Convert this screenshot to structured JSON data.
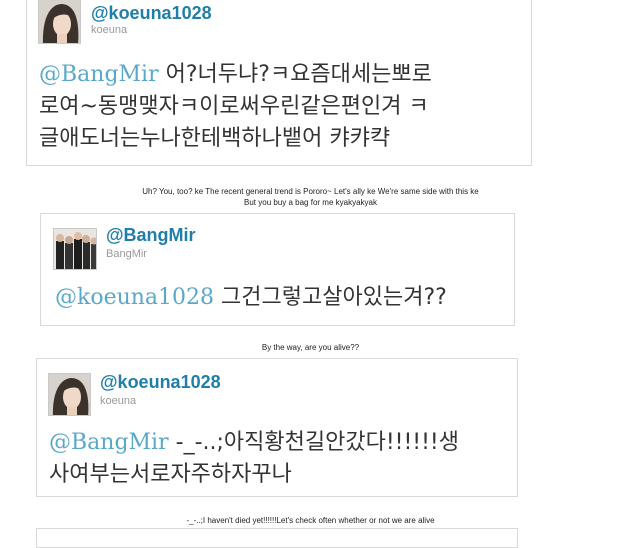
{
  "tweet1": {
    "handle": "@koeuna1028",
    "username": "koeuna",
    "mention": "@BangMir",
    "line1": "어?너두냐?ㅋ요즘대세는뽀로",
    "line2": "로여~동맹맺자ㅋ이로써우린같은편인겨 ㅋ",
    "line3": "글애도너는누나한테백하나뱉어 캬캬캭"
  },
  "caption1": {
    "line1": "Uh? You, too? ke The recent general trend is Pororo~ Let's ally ke We're same side with this ke",
    "line2": "But you buy a bag for me kyakyakyak"
  },
  "tweet2": {
    "handle": "@BangMir",
    "username": "BangMir",
    "mention": "@koeuna1028",
    "line1": "그건그렇고살아있는겨??"
  },
  "caption2": {
    "line1": "By the way, are you alive??"
  },
  "tweet3": {
    "handle": "@koeuna1028",
    "username": "koeuna",
    "mention": "@BangMir",
    "line1": "-_-..;아직황천길안갔다!!!!!!생",
    "line2": "사여부는서로자주하자꾸나"
  },
  "caption3": {
    "line1": "-_-..;I haven't died yet!!!!!!Let's check often whether or not we are alive"
  }
}
